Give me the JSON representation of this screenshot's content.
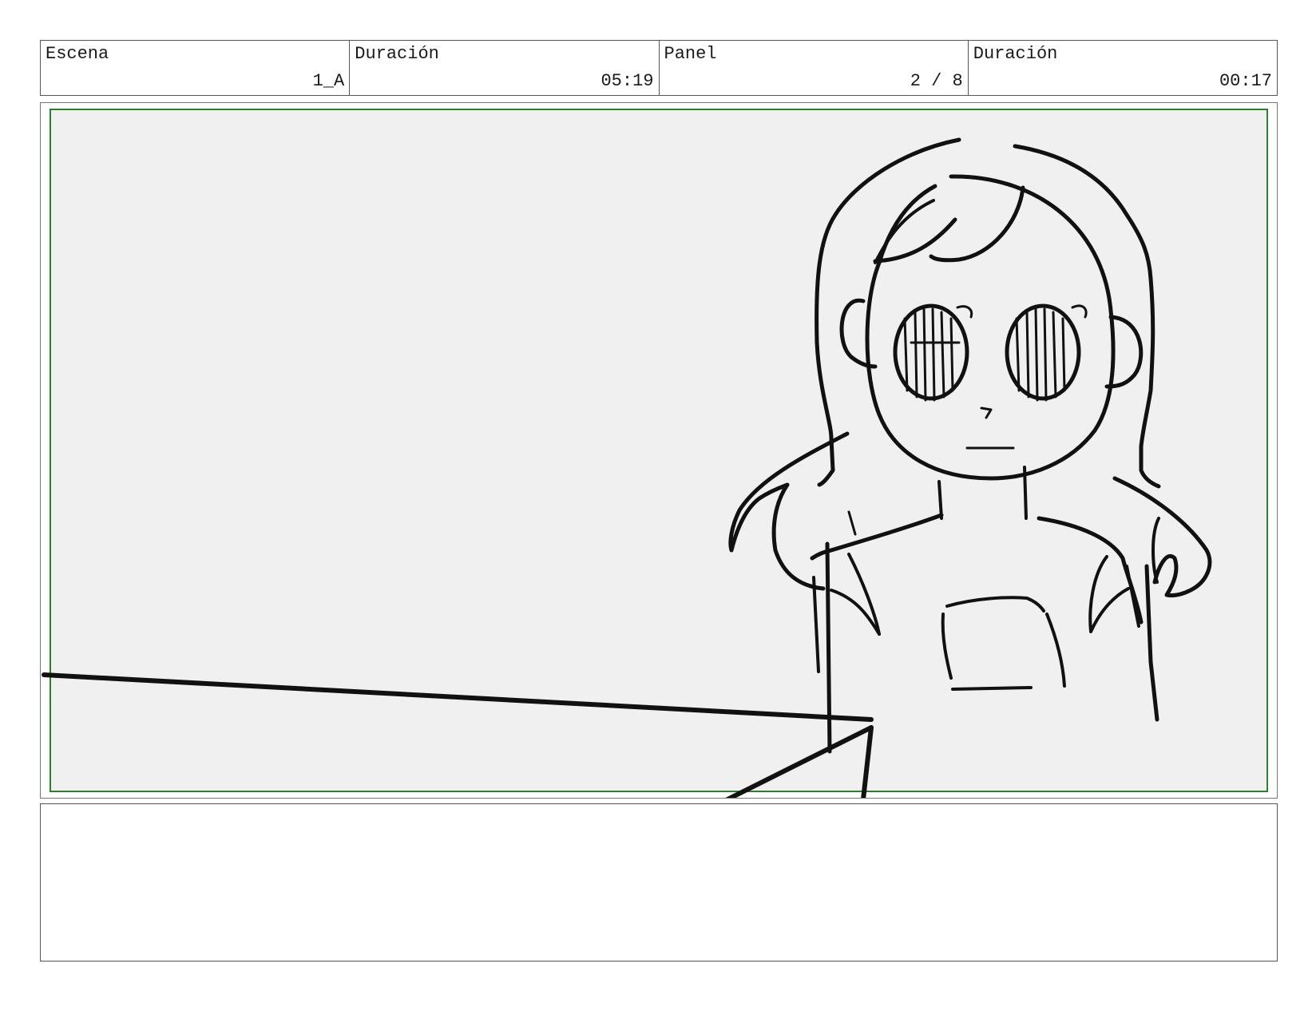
{
  "header": {
    "scene_label": "Escena",
    "scene_value": "1_A",
    "scene_duration_label": "Duración",
    "scene_duration_value": "05:19",
    "panel_label": "Panel",
    "panel_value": "2 / 8",
    "panel_duration_label": "Duración",
    "panel_duration_value": "00:17"
  },
  "notes": {
    "text": ""
  },
  "colors": {
    "safe_area_border": "#2e7d32",
    "panel_background": "#f0f0f0",
    "sketch_stroke": "#111111"
  }
}
